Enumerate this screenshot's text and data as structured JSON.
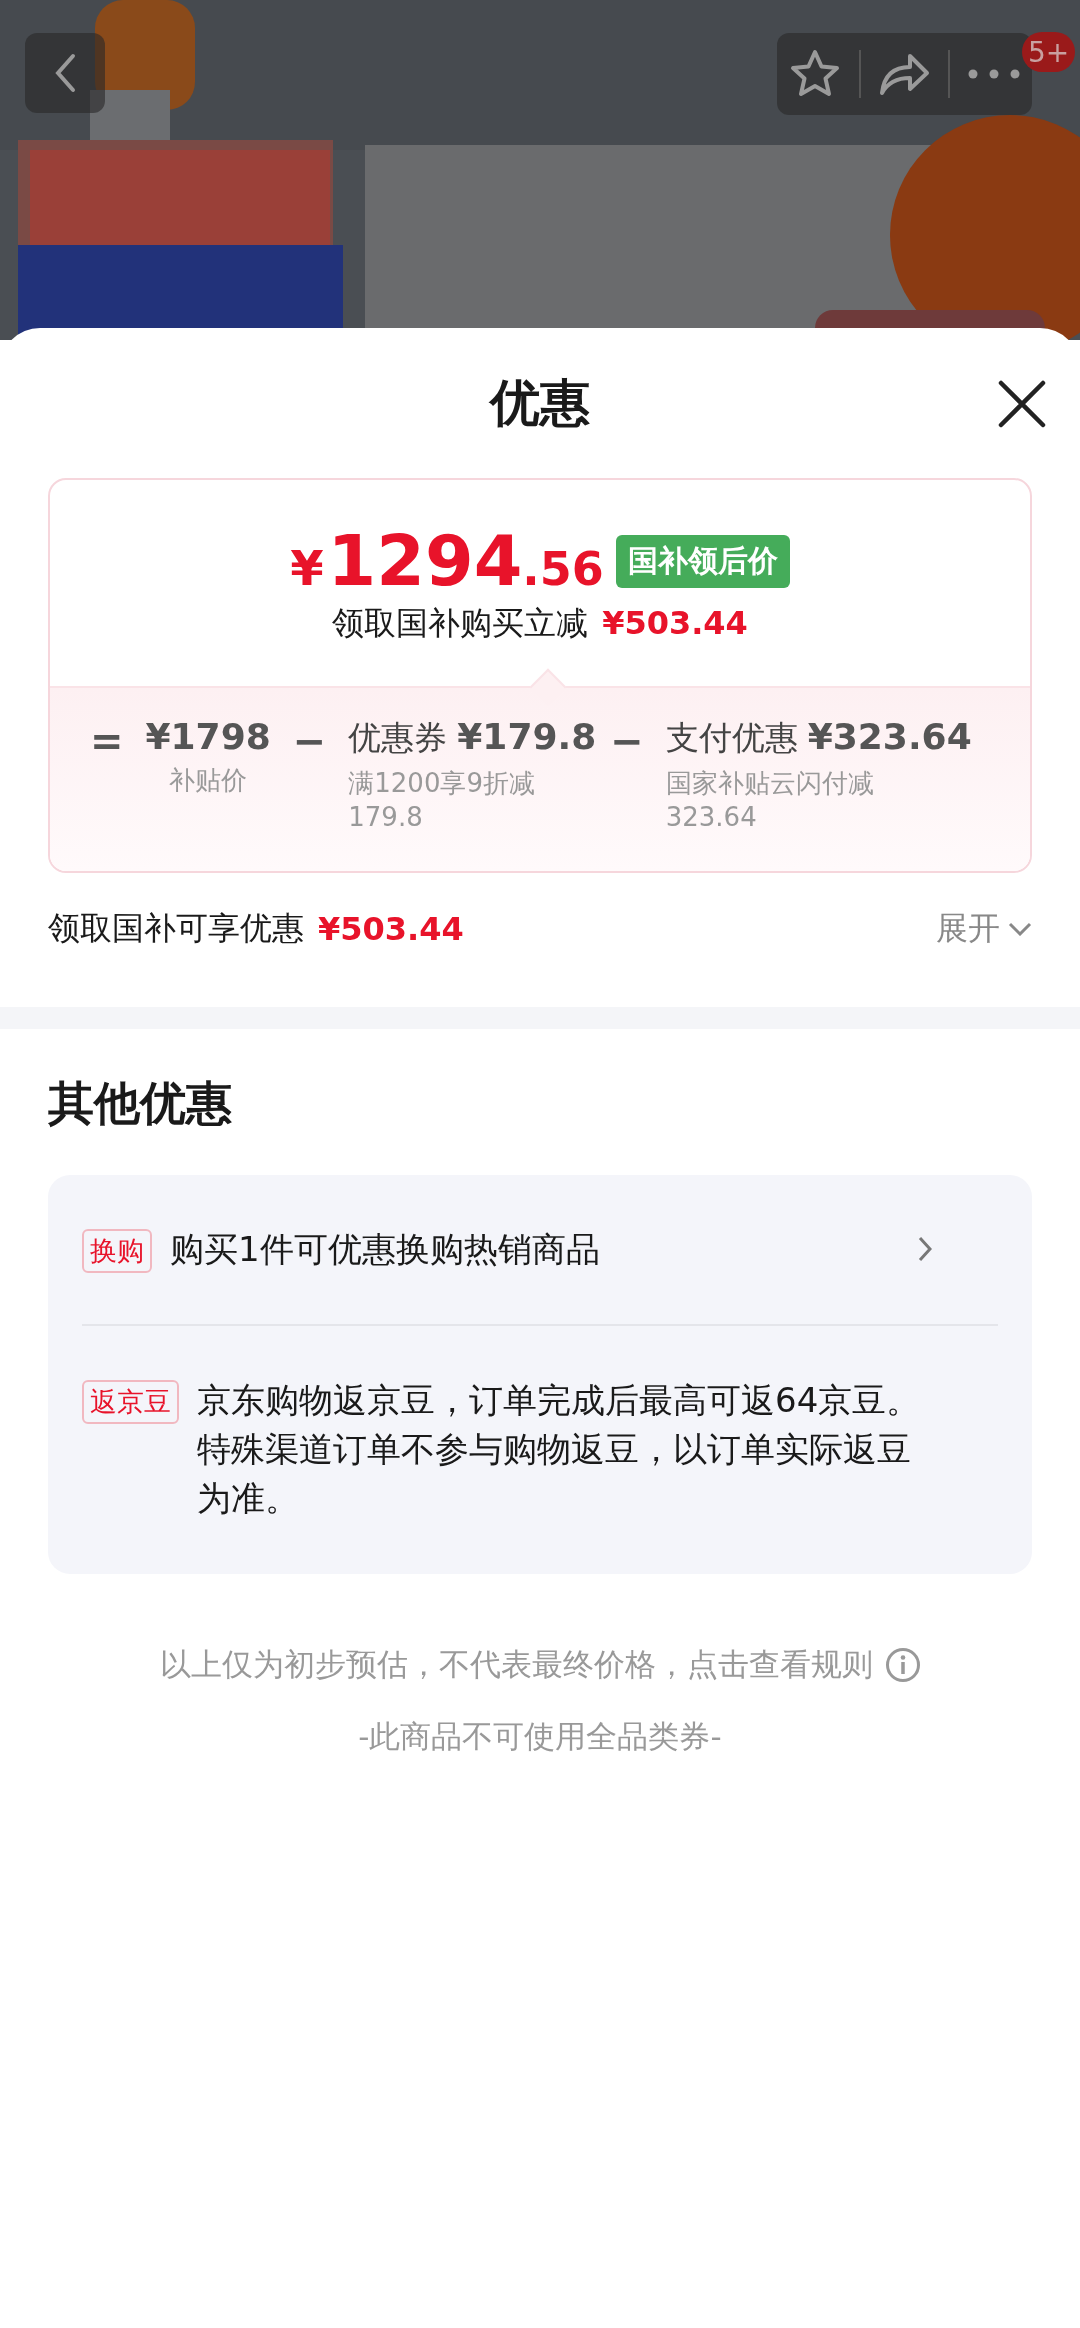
{
  "header": {
    "badge": "5+"
  },
  "sheet": {
    "title": "优惠",
    "price": {
      "currency": "¥",
      "integer": "1294",
      "decimal": ".56",
      "tag": "国补领后价",
      "summary_label": "领取国补购买立减",
      "summary_amount": "¥503.44"
    },
    "breakdown": [
      {
        "kind": "base",
        "operator": "=",
        "amount": "¥1798",
        "note": "补贴价"
      },
      {
        "kind": "discount",
        "operator": "−",
        "label": "优惠券",
        "amount": "¥179.8",
        "note": "满1200享9折减179.8"
      },
      {
        "kind": "discount",
        "operator": "−",
        "label": "支付优惠",
        "amount": "¥323.64",
        "note": "国家补贴云闪付减323.64"
      }
    ],
    "total": {
      "label": "领取国补可享优惠",
      "amount": "¥503.44",
      "expand": "展开"
    },
    "other": {
      "title": "其他优惠",
      "items": [
        {
          "tag": "换购",
          "text": "购买1件可优惠换购热销商品",
          "link": true
        },
        {
          "tag": "返京豆",
          "text": "京东购物返京豆，订单完成后最高可返64京豆。特殊渠道订单不参与购物返豆，以订单实际返豆为准。",
          "link": false
        }
      ]
    },
    "notes": {
      "disclaimer": "以上仅为初步预估，不代表最终价格，点击查看规则",
      "restriction": "-此商品不可使用全品类券-"
    }
  }
}
